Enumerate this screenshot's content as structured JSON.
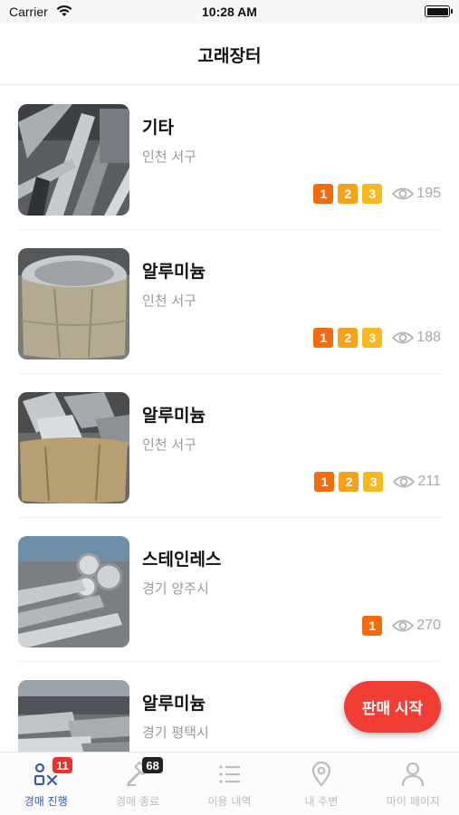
{
  "status_bar": {
    "carrier": "Carrier",
    "time": "10:28 AM"
  },
  "header": {
    "title": "고래장터"
  },
  "listings": [
    {
      "name": "기타",
      "location": "인천 서구",
      "badges": [
        "1",
        "2",
        "3"
      ],
      "views": "195"
    },
    {
      "name": "알루미늄",
      "location": "인천 서구",
      "badges": [
        "1",
        "2",
        "3"
      ],
      "views": "188"
    },
    {
      "name": "알루미늄",
      "location": "인천 서구",
      "badges": [
        "1",
        "2",
        "3"
      ],
      "views": "211"
    },
    {
      "name": "스테인레스",
      "location": "경기 양주시",
      "badges": [
        "1"
      ],
      "views": "270"
    },
    {
      "name": "알루미늄",
      "location": "경기 평택시",
      "badges": [],
      "views": ""
    }
  ],
  "fab": {
    "label": "판매 시작"
  },
  "tabs": [
    {
      "label": "경매 진행",
      "badge": "11",
      "icon": "auction-icon",
      "active": true
    },
    {
      "label": "경매 종료",
      "badge": "68",
      "icon": "gavel-icon",
      "active": false
    },
    {
      "label": "이용 내역",
      "badge": "",
      "icon": "list-icon",
      "active": false
    },
    {
      "label": "내 주변",
      "badge": "",
      "icon": "location-pin-icon",
      "active": false
    },
    {
      "label": "마이 페이지",
      "badge": "",
      "icon": "person-icon",
      "active": false
    }
  ],
  "colors": {
    "accent": "#f23d35",
    "tab_active": "#3b5aa6",
    "badge_1": "#f26b0f",
    "badge_2": "#f7a01a",
    "badge_3": "#f8b81e"
  }
}
